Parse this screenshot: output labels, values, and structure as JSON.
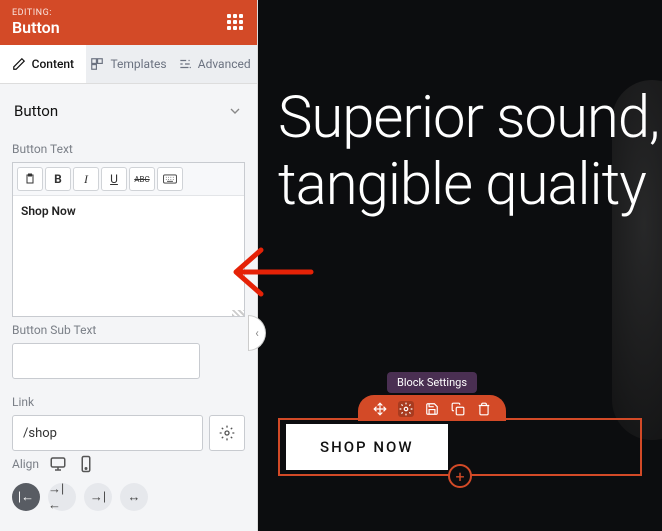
{
  "header": {
    "editing_label": "EDITING:",
    "title": "Button"
  },
  "tabs": [
    {
      "label": "Content",
      "active": true
    },
    {
      "label": "Templates",
      "active": false
    },
    {
      "label": "Advanced",
      "active": false
    }
  ],
  "section": {
    "title": "Button"
  },
  "fields": {
    "button_text": {
      "label": "Button Text",
      "value": "Shop Now"
    },
    "button_sub_text": {
      "label": "Button Sub Text",
      "value": ""
    },
    "link": {
      "label": "Link",
      "value": "/shop"
    },
    "align": {
      "label": "Align"
    }
  },
  "preview": {
    "hero": "Superior sound, tangible quality",
    "tooltip": "Block Settings",
    "button_label": "SHOP NOW"
  },
  "colors": {
    "accent": "#d34a27"
  }
}
